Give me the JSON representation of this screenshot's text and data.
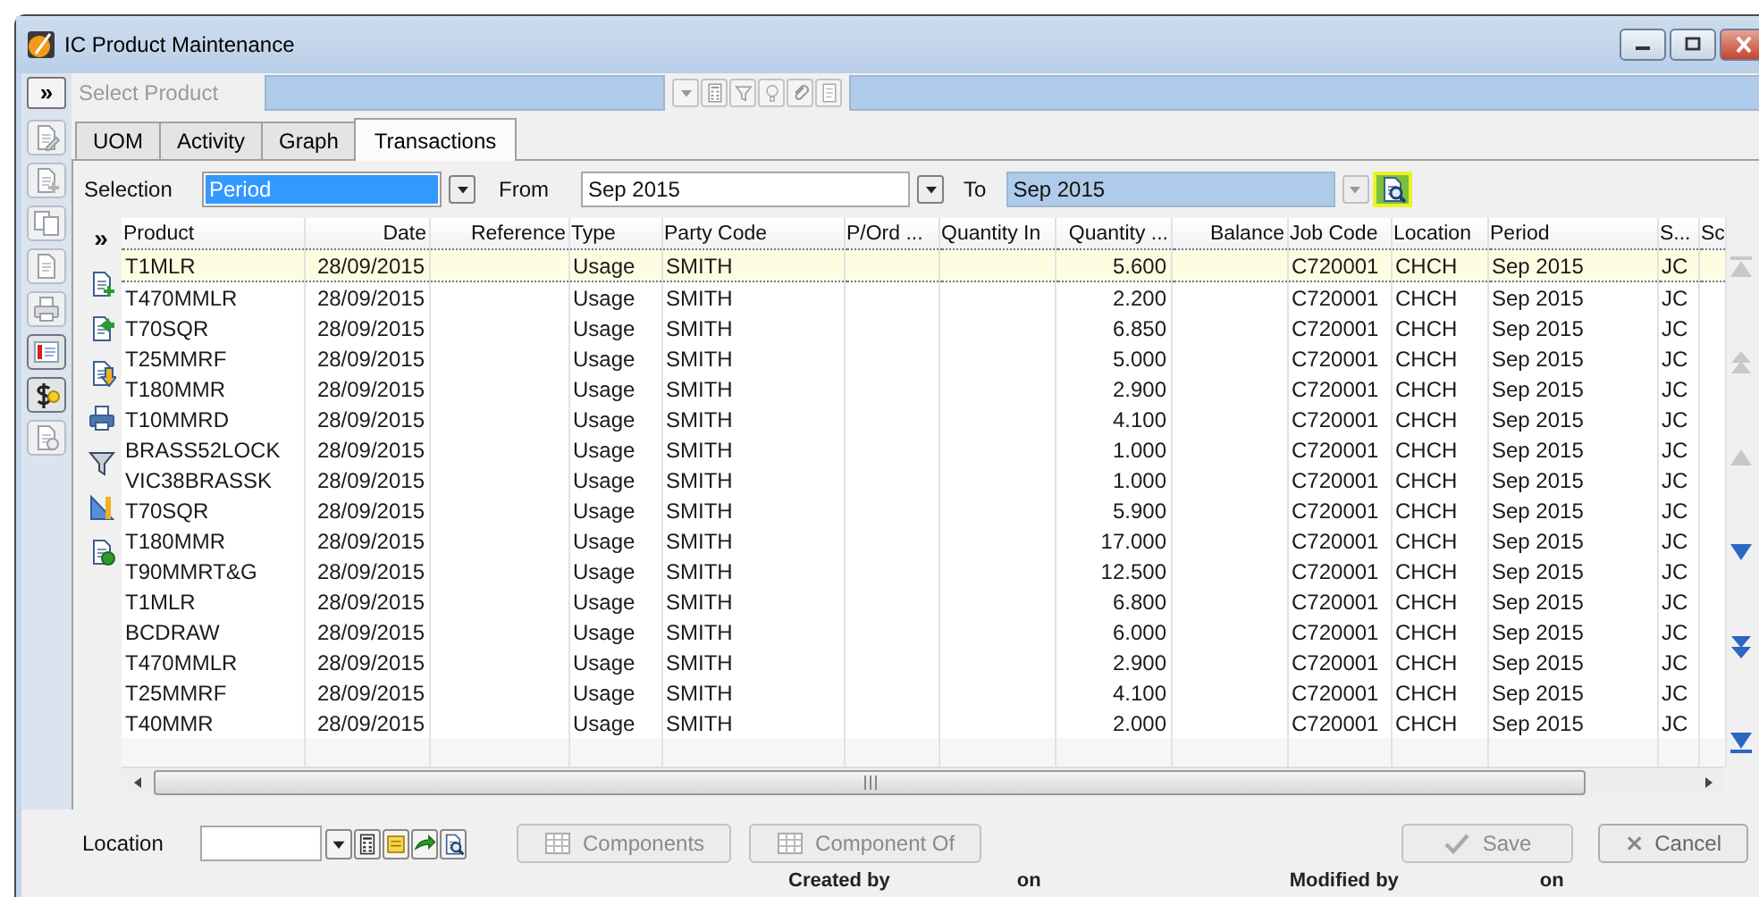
{
  "window": {
    "title": "IC Product Maintenance"
  },
  "expand_button": {
    "label": "»"
  },
  "side_toolbar": [
    {
      "kind": "edit",
      "disabled": true
    },
    {
      "kind": "new",
      "disabled": true
    },
    {
      "kind": "copy",
      "disabled": true
    },
    {
      "kind": "document",
      "disabled": true
    },
    {
      "kind": "print",
      "disabled": true
    },
    {
      "kind": "list",
      "disabled": false
    },
    {
      "kind": "cost",
      "disabled": false
    },
    {
      "kind": "query",
      "disabled": true
    }
  ],
  "product_selector": {
    "label": "Select Product",
    "disabled": true
  },
  "tabs": [
    {
      "label": "UOM",
      "selected": false
    },
    {
      "label": "Activity",
      "selected": false
    },
    {
      "label": "Graph",
      "selected": false
    },
    {
      "label": "Transactions",
      "selected": true
    }
  ],
  "filter": {
    "selection_label": "Selection",
    "selection_value": "Period",
    "from_label": "From",
    "from_value": "Sep 2015",
    "to_label": "To",
    "to_value": "Sep 2015",
    "to_disabled": true
  },
  "grid": {
    "expand_label": "»",
    "columns": [
      "Product",
      "Date",
      "Reference",
      "Type",
      "Party Code",
      "P/Ord ...",
      "Quantity In",
      "Quantity ...",
      "Balance",
      "Job Code",
      "Location",
      "Period",
      "S...",
      "Sc"
    ],
    "rows": [
      {
        "selected": true,
        "product": "T1MLR",
        "date": "28/09/2015",
        "type": "Usage",
        "party_code": "SMITH",
        "quantity": "5.600",
        "job_code": "C720001",
        "location": "CHCH",
        "period": "Sep 2015",
        "s": "JC"
      },
      {
        "selected": false,
        "product": "T470MMLR",
        "date": "28/09/2015",
        "type": "Usage",
        "party_code": "SMITH",
        "quantity": "2.200",
        "job_code": "C720001",
        "location": "CHCH",
        "period": "Sep 2015",
        "s": "JC"
      },
      {
        "selected": false,
        "product": "T70SQR",
        "date": "28/09/2015",
        "type": "Usage",
        "party_code": "SMITH",
        "quantity": "6.850",
        "job_code": "C720001",
        "location": "CHCH",
        "period": "Sep 2015",
        "s": "JC"
      },
      {
        "selected": false,
        "product": "T25MMRF",
        "date": "28/09/2015",
        "type": "Usage",
        "party_code": "SMITH",
        "quantity": "5.000",
        "job_code": "C720001",
        "location": "CHCH",
        "period": "Sep 2015",
        "s": "JC"
      },
      {
        "selected": false,
        "product": "T180MMR",
        "date": "28/09/2015",
        "type": "Usage",
        "party_code": "SMITH",
        "quantity": "2.900",
        "job_code": "C720001",
        "location": "CHCH",
        "period": "Sep 2015",
        "s": "JC"
      },
      {
        "selected": false,
        "product": "T10MMRD",
        "date": "28/09/2015",
        "type": "Usage",
        "party_code": "SMITH",
        "quantity": "4.100",
        "job_code": "C720001",
        "location": "CHCH",
        "period": "Sep 2015",
        "s": "JC"
      },
      {
        "selected": false,
        "product": "BRASS52LOCK",
        "date": "28/09/2015",
        "type": "Usage",
        "party_code": "SMITH",
        "quantity": "1.000",
        "job_code": "C720001",
        "location": "CHCH",
        "period": "Sep 2015",
        "s": "JC"
      },
      {
        "selected": false,
        "product": "VIC38BRASSK",
        "date": "28/09/2015",
        "type": "Usage",
        "party_code": "SMITH",
        "quantity": "1.000",
        "job_code": "C720001",
        "location": "CHCH",
        "period": "Sep 2015",
        "s": "JC"
      },
      {
        "selected": false,
        "product": "T70SQR",
        "date": "28/09/2015",
        "type": "Usage",
        "party_code": "SMITH",
        "quantity": "5.900",
        "job_code": "C720001",
        "location": "CHCH",
        "period": "Sep 2015",
        "s": "JC"
      },
      {
        "selected": false,
        "product": "T180MMR",
        "date": "28/09/2015",
        "type": "Usage",
        "party_code": "SMITH",
        "quantity": "17.000",
        "job_code": "C720001",
        "location": "CHCH",
        "period": "Sep 2015",
        "s": "JC"
      },
      {
        "selected": false,
        "product": "T90MMRT&G",
        "date": "28/09/2015",
        "type": "Usage",
        "party_code": "SMITH",
        "quantity": "12.500",
        "job_code": "C720001",
        "location": "CHCH",
        "period": "Sep 2015",
        "s": "JC"
      },
      {
        "selected": false,
        "product": "T1MLR",
        "date": "28/09/2015",
        "type": "Usage",
        "party_code": "SMITH",
        "quantity": "6.800",
        "job_code": "C720001",
        "location": "CHCH",
        "period": "Sep 2015",
        "s": "JC"
      },
      {
        "selected": false,
        "product": "BCDRAW",
        "date": "28/09/2015",
        "type": "Usage",
        "party_code": "SMITH",
        "quantity": "6.000",
        "job_code": "C720001",
        "location": "CHCH",
        "period": "Sep 2015",
        "s": "JC"
      },
      {
        "selected": false,
        "product": "T470MMLR",
        "date": "28/09/2015",
        "type": "Usage",
        "party_code": "SMITH",
        "quantity": "2.900",
        "job_code": "C720001",
        "location": "CHCH",
        "period": "Sep 2015",
        "s": "JC"
      },
      {
        "selected": false,
        "product": "T25MMRF",
        "date": "28/09/2015",
        "type": "Usage",
        "party_code": "SMITH",
        "quantity": "4.100",
        "job_code": "C720001",
        "location": "CHCH",
        "period": "Sep 2015",
        "s": "JC"
      },
      {
        "selected": false,
        "product": "T40MMR",
        "date": "28/09/2015",
        "type": "Usage",
        "party_code": "SMITH",
        "quantity": "2.000",
        "job_code": "C720001",
        "location": "CHCH",
        "period": "Sep 2015",
        "s": "JC"
      }
    ]
  },
  "record_nav": [
    {
      "kind": "first",
      "disabled": true
    },
    {
      "kind": "page_up",
      "disabled": true
    },
    {
      "kind": "up",
      "disabled": true
    },
    {
      "kind": "down",
      "disabled": false
    },
    {
      "kind": "page_down",
      "disabled": false
    },
    {
      "kind": "last",
      "disabled": false
    }
  ],
  "footer": {
    "location_label": "Location",
    "buttons": [
      {
        "label": "Components",
        "disabled": true
      },
      {
        "label": "Component Of",
        "disabled": true
      }
    ],
    "save": {
      "label": "Save",
      "disabled": true
    },
    "cancel": {
      "label": "Cancel",
      "disabled": false
    },
    "created_by_label": "Created by",
    "created_on_label": "on",
    "modified_by_label": "Modified by",
    "modified_on_label": "on"
  }
}
